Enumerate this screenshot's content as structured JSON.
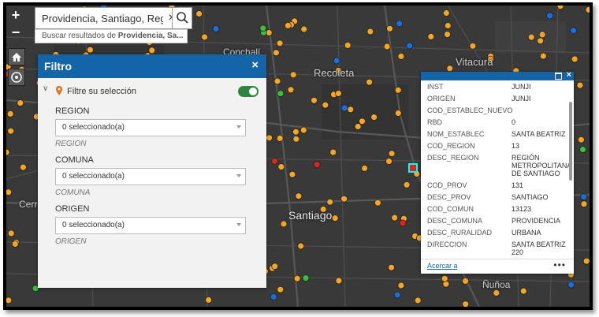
{
  "map": {
    "places": [
      "Conchalí",
      "Recoleta",
      "Vitacura",
      "Santiago",
      "Cerr",
      "Ñuñoa"
    ],
    "point_colors": {
      "orange": "#f6a623",
      "blue": "#1a6fe0",
      "red": "#e5231d",
      "green": "#39c13a"
    }
  },
  "controls": {
    "zoom_in": "+",
    "zoom_out": "−"
  },
  "search": {
    "value": "Providencia, Santiago, Región M",
    "suggestion_prefix": "Buscar resultados de ",
    "suggestion_term": "Providencia, Sa..."
  },
  "filter_panel": {
    "title": "Filtro",
    "close": "×",
    "expression_label": "Filtre su selección",
    "toggle_on": true,
    "fields": [
      {
        "label": "REGION",
        "value": "0 seleccionado(a)",
        "hint": "REGION"
      },
      {
        "label": "COMUNA",
        "value": "0 seleccionado(a)",
        "hint": "COMUNA"
      },
      {
        "label": "ORIGEN",
        "value": "0 seleccionado(a)",
        "hint": "ORIGEN"
      }
    ]
  },
  "popup": {
    "close": "×",
    "attributes": [
      {
        "key": "INST",
        "value": "JUNJI"
      },
      {
        "key": "ORIGEN",
        "value": "JUNJI"
      },
      {
        "key": "COD_ESTABLEC_NUEVO",
        "value": ""
      },
      {
        "key": "RBD",
        "value": "0"
      },
      {
        "key": "NOM_ESTABLEC",
        "value": "SANTA BEATRIZ"
      },
      {
        "key": "COD_REGION",
        "value": "13"
      },
      {
        "key": "DESC_REGION",
        "value": "REGIÓN METROPOLITANA DE SANTIAGO"
      },
      {
        "key": "COD_PROV",
        "value": "131"
      },
      {
        "key": "DESC_PROV",
        "value": "SANTIAGO"
      },
      {
        "key": "COD_COMUN",
        "value": "13123"
      },
      {
        "key": "DESC_COMUNA",
        "value": "PROVIDENCIA"
      },
      {
        "key": "DESC_RURALIDAD",
        "value": "URBANA"
      },
      {
        "key": "DIRECCION",
        "value": "SANTA BEATRIZ 220"
      }
    ],
    "zoom_to": "Acercar a",
    "more": "•••"
  }
}
